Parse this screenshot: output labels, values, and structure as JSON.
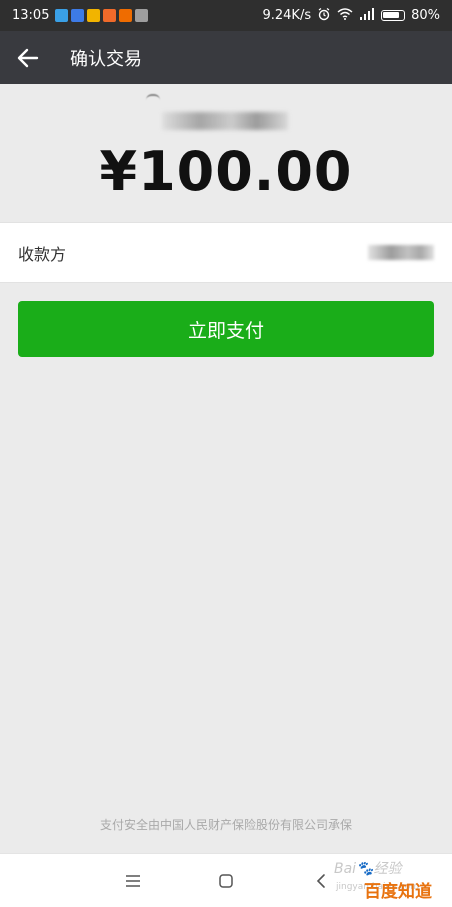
{
  "status_bar": {
    "time": "13:05",
    "network_speed": "9.24K/s",
    "battery_percent": "80%",
    "app_icon_colors": [
      "#3aa0e6",
      "#3d7be6",
      "#f2b400",
      "#f06a2a",
      "#ef6c00",
      "#9e9e9e"
    ]
  },
  "header": {
    "title": "确认交易"
  },
  "amount": {
    "value": "¥100.00"
  },
  "payee": {
    "label": "收款方"
  },
  "pay_button": {
    "label": "立即支付"
  },
  "footer": {
    "security_note": "支付安全由中国人民财产保险股份有限公司承保"
  },
  "watermark": {
    "baidu": "Bai",
    "jingyan": "经验",
    "url": "jingyan.baidu.com",
    "zhidao": "百度知道"
  },
  "colors": {
    "status_bar_bg": "#2f2f2f",
    "header_bg": "#393a3f",
    "page_bg": "#ebebeb",
    "pay_button_bg": "#1aad19"
  }
}
